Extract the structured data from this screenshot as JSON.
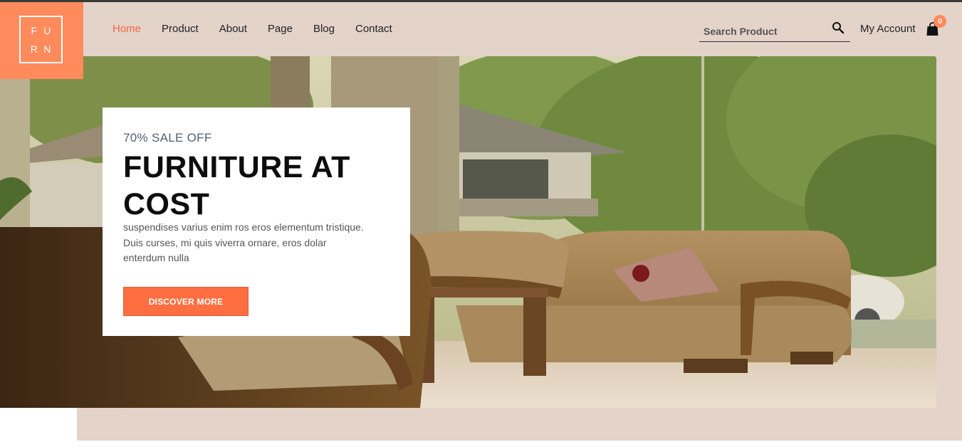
{
  "brand": {
    "logo_letters": [
      "F",
      "U",
      "R",
      "N"
    ]
  },
  "nav": {
    "items": [
      {
        "label": "Home",
        "active": true
      },
      {
        "label": "Product",
        "active": false
      },
      {
        "label": "About",
        "active": false
      },
      {
        "label": "Page",
        "active": false
      },
      {
        "label": "Blog",
        "active": false
      },
      {
        "label": "Contact",
        "active": false
      }
    ]
  },
  "search": {
    "placeholder": "Search Product",
    "icon": "search-icon"
  },
  "account": {
    "label": "My Account"
  },
  "cart": {
    "count": "0",
    "icon": "shopping-bag-icon"
  },
  "hero": {
    "kicker": "70% SALE OFF",
    "headline": "FURNITURE AT COST",
    "description": "suspendises varius enim ros eros elementum tristique. Duis curses, mi quis viverra ornare, eros dolar enterdum nulla",
    "cta_label": "DISCOVER MORE",
    "image": "living-room-sofa-photo"
  },
  "colors": {
    "accent": "#ff6e40",
    "logo_bg": "#ff8a5b",
    "band": "#e4d3c9",
    "active_nav": "#f2694a"
  }
}
